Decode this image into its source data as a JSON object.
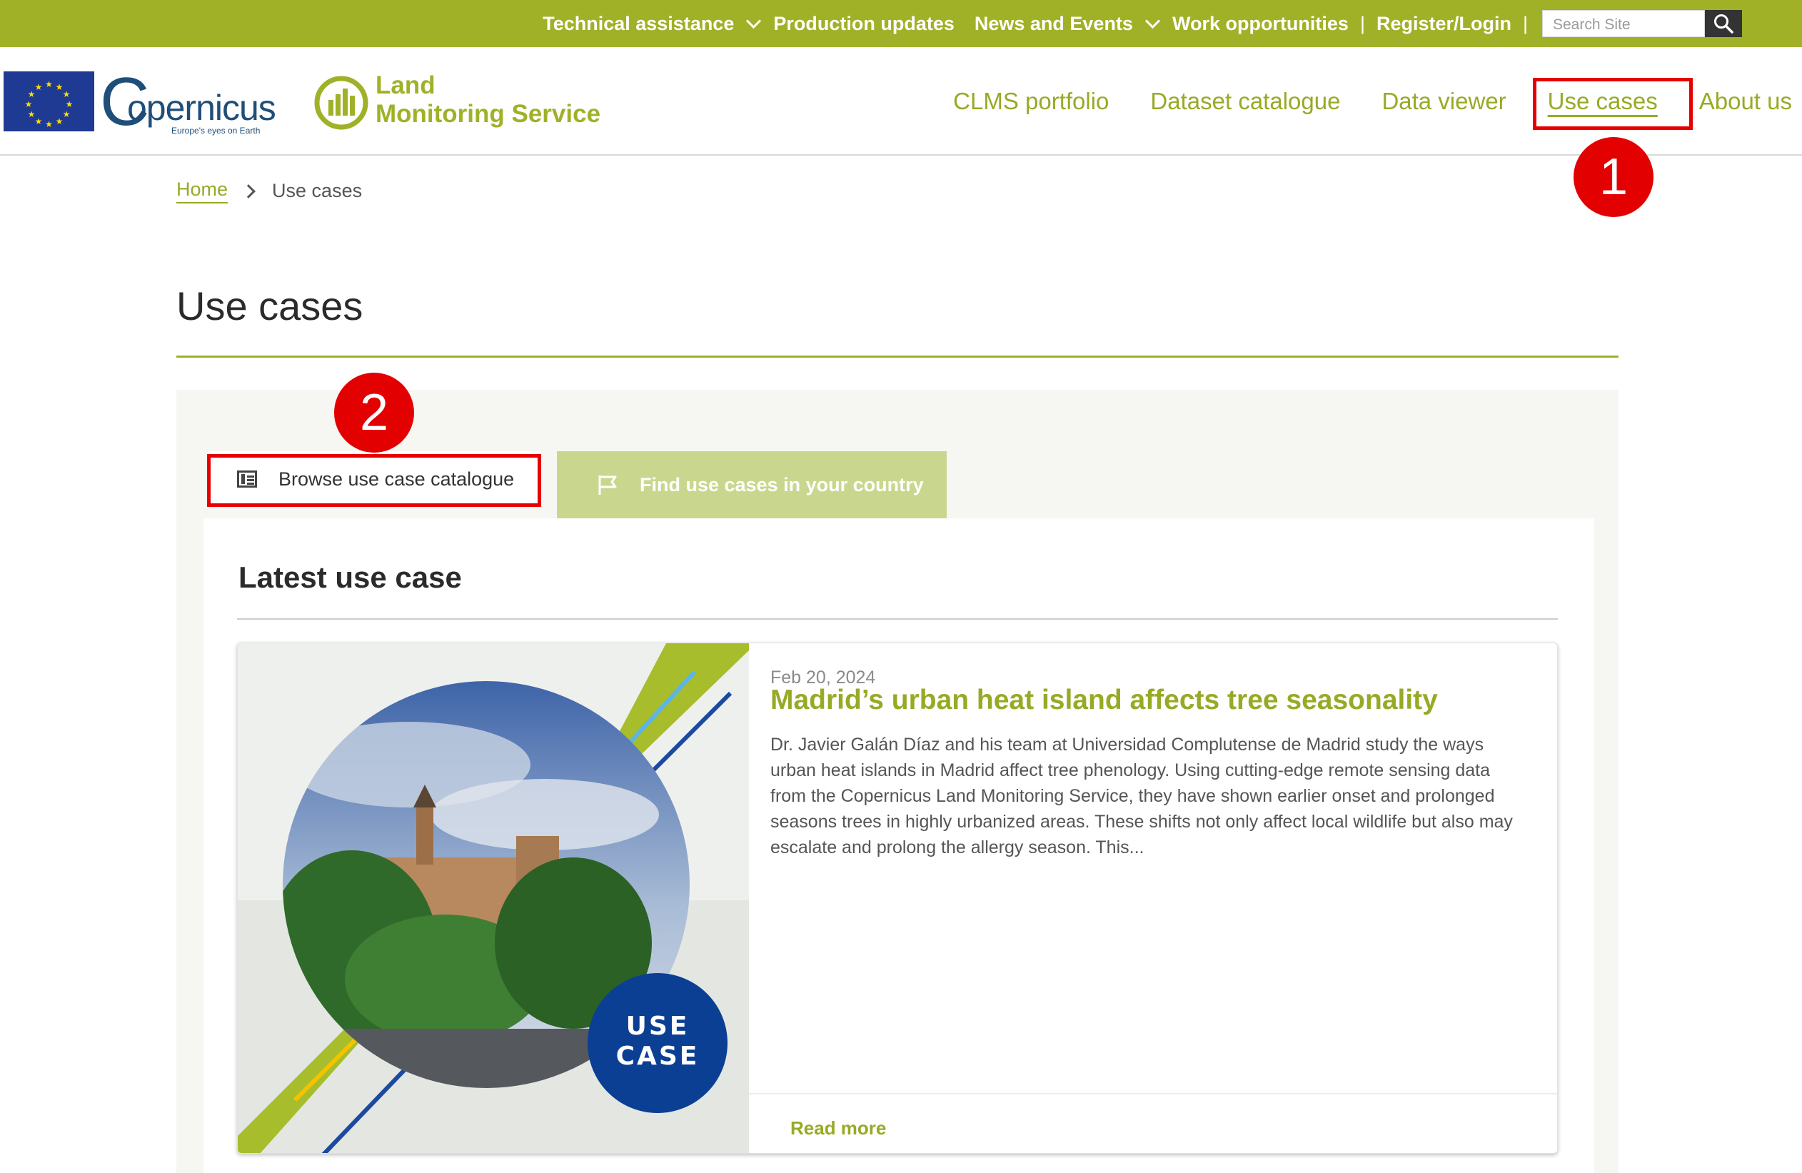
{
  "topnav": {
    "technical_assistance": "Technical assistance",
    "production_updates": "Production updates",
    "news_events": "News and Events",
    "work_opportunities": "Work opportunities",
    "register_login": "Register/Login",
    "separator": "|",
    "search_placeholder": "Search Site"
  },
  "header": {
    "copernicus_word": "opernicus",
    "copernicus_c": "C",
    "copernicus_tagline": "Europe's eyes on Earth",
    "clms_line1": "Land",
    "clms_line2": "Monitoring Service",
    "nav": [
      "CLMS portfolio",
      "Dataset catalogue",
      "Data viewer",
      "Use cases",
      "About us"
    ]
  },
  "breadcrumb": {
    "home": "Home",
    "current": "Use cases"
  },
  "page": {
    "title": "Use cases"
  },
  "tabs": {
    "browse": "Browse use case catalogue",
    "find": "Find use cases in your country"
  },
  "latest": {
    "heading": "Latest use case",
    "date": "Feb 20, 2024",
    "title": "Madrid’s urban heat island affects tree seasonality",
    "body": "Dr. Javier Galán Díaz and his team at Universidad Complutense de Madrid study the ways urban heat islands in Madrid affect tree phenology. Using cutting-edge remote sensing data from the Copernicus Land Monitoring Service, they have shown earlier onset and prolonged seasons trees in highly urbanized areas. These shifts not only affect local wildlife but also may escalate and prolong the allergy season. This...",
    "badge_line1": "USE",
    "badge_line2": "CASE",
    "read_more": "Read more"
  },
  "annotations": {
    "one": "1",
    "two": "2"
  },
  "colors": {
    "brand_green": "#a0b128",
    "link_green": "#98aa25",
    "annotation_red": "#e60000",
    "badge_blue": "#0b3f94",
    "eu_blue": "#1f3a93"
  }
}
